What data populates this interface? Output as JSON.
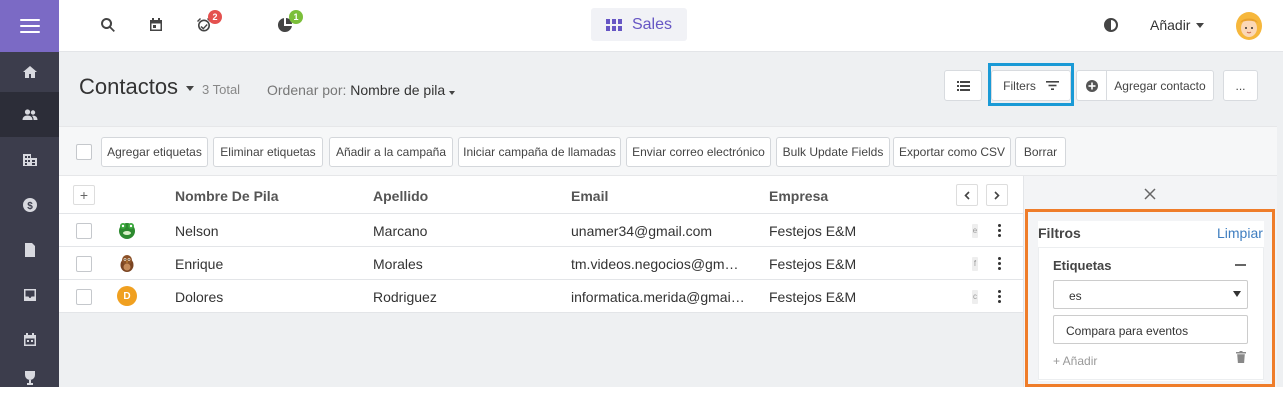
{
  "colors": {
    "sidebar": "#3c3d4c",
    "sidebar_top": "#7b6ac5",
    "accent": "#6656c4",
    "link": "#3f7ec0",
    "highlight_blue": "#1a9ad6",
    "highlight_orange": "#ef7d2a",
    "badge_red": "#e4514f",
    "badge_green": "#7bbf3a"
  },
  "sidebar": {
    "items": [
      {
        "icon": "home-icon"
      },
      {
        "icon": "contacts-icon"
      },
      {
        "icon": "companies-icon"
      },
      {
        "icon": "deals-icon"
      },
      {
        "icon": "documents-icon"
      },
      {
        "icon": "inbox-icon"
      },
      {
        "icon": "calendar-icon"
      },
      {
        "icon": "trophy-icon"
      }
    ]
  },
  "topbar": {
    "reminders_badge": "2",
    "reports_badge": "1",
    "app_name": "Sales",
    "add_label": "Añadir"
  },
  "header": {
    "title": "Contactos",
    "total": "3 Total",
    "sort_prefix": "Ordenar por:",
    "sort_value": "Nombre de pila",
    "filters_label": "Filters",
    "add_contact_label": "Agregar contacto",
    "more_label": "..."
  },
  "actions": {
    "add_tags": "Agregar etiquetas",
    "remove_tags": "Eliminar etiquetas",
    "add_campaign": "Añadir a la campaña",
    "call_campaign": "Iniciar campaña de llamadas",
    "send_email": "Enviar correo electrónico",
    "bulk_update": "Bulk Update Fields",
    "export_csv": "Exportar como CSV",
    "delete": "Borrar"
  },
  "table": {
    "columns": {
      "first_name": "Nombre De Pila",
      "last_name": "Apellido",
      "email": "Email",
      "company": "Empresa"
    },
    "rows": [
      {
        "first": "Nelson",
        "last": "Marcano",
        "email": "unamer34@gmail.com",
        "company": "Festejos E&M",
        "stub": "e"
      },
      {
        "first": "Enrique",
        "last": "Morales",
        "email": "tm.videos.negocios@gmai…",
        "company": "Festejos E&M",
        "stub": "f"
      },
      {
        "first": "Dolores",
        "last": "Rodriguez",
        "email": "informatica.merida@gmai…",
        "company": "Festejos E&M",
        "stub": "c",
        "initial": "D"
      }
    ]
  },
  "filters": {
    "title": "Filtros",
    "clear": "Limpiar",
    "group_title": "Etiquetas",
    "operator": "es",
    "value": "Compara para eventos",
    "add_label": "+ Añadir"
  }
}
